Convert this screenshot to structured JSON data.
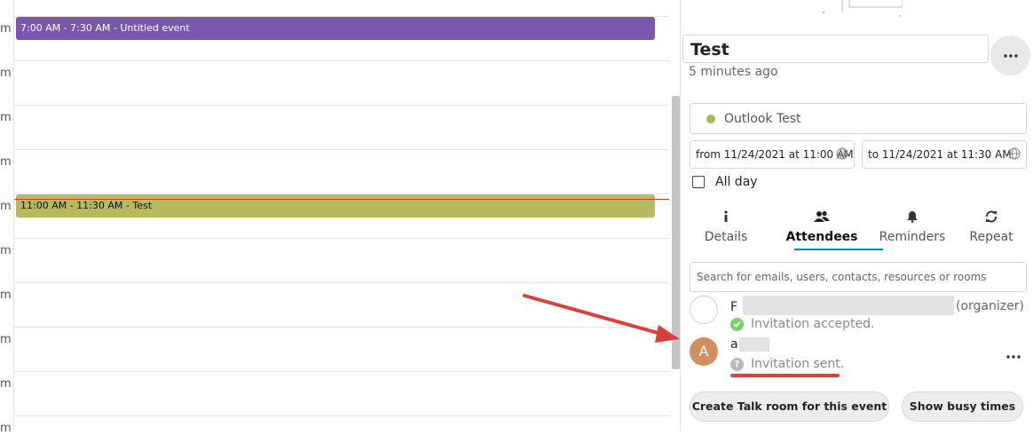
{
  "calendar": {
    "hour_labels": [
      "m",
      "m",
      "m",
      "m",
      "m",
      "m",
      "m",
      "m",
      "m",
      "m"
    ],
    "events": [
      {
        "label": "7:00 AM - 7:30 AM - Untitled event",
        "color": "#7b56ad"
      },
      {
        "label": "11:00 AM - 11:30 AM - Test",
        "color": "#b6b95d"
      }
    ]
  },
  "event_editor": {
    "title": "Test",
    "last_modified": "5 minutes ago",
    "calendar_name": "Outlook Test",
    "calendar_color": "#a8b85a",
    "from": "from 11/24/2021 at 11:00 AM",
    "to": "to 11/24/2021 at 11:30 AM",
    "all_day_label": "All day",
    "all_day_checked": false,
    "tabs": [
      {
        "label": "Details",
        "icon": "info-icon"
      },
      {
        "label": "Attendees",
        "icon": "people-icon",
        "active": true
      },
      {
        "label": "Reminders",
        "icon": "bell-icon"
      },
      {
        "label": "Repeat",
        "icon": "repeat-icon"
      }
    ],
    "search_placeholder": "Search for emails, users, contacts, resources or rooms",
    "attendees": [
      {
        "name": "F",
        "role": "(organizer)",
        "status": "Invitation accepted.",
        "status_icon": "check-icon"
      },
      {
        "name": "a",
        "avatar_letter": "A",
        "status": "Invitation sent.",
        "status_icon": "question-icon"
      }
    ],
    "buttons": {
      "talk": "Create Talk room for this event",
      "busy": "Show busy times"
    }
  },
  "accent_color": "#0082c9"
}
